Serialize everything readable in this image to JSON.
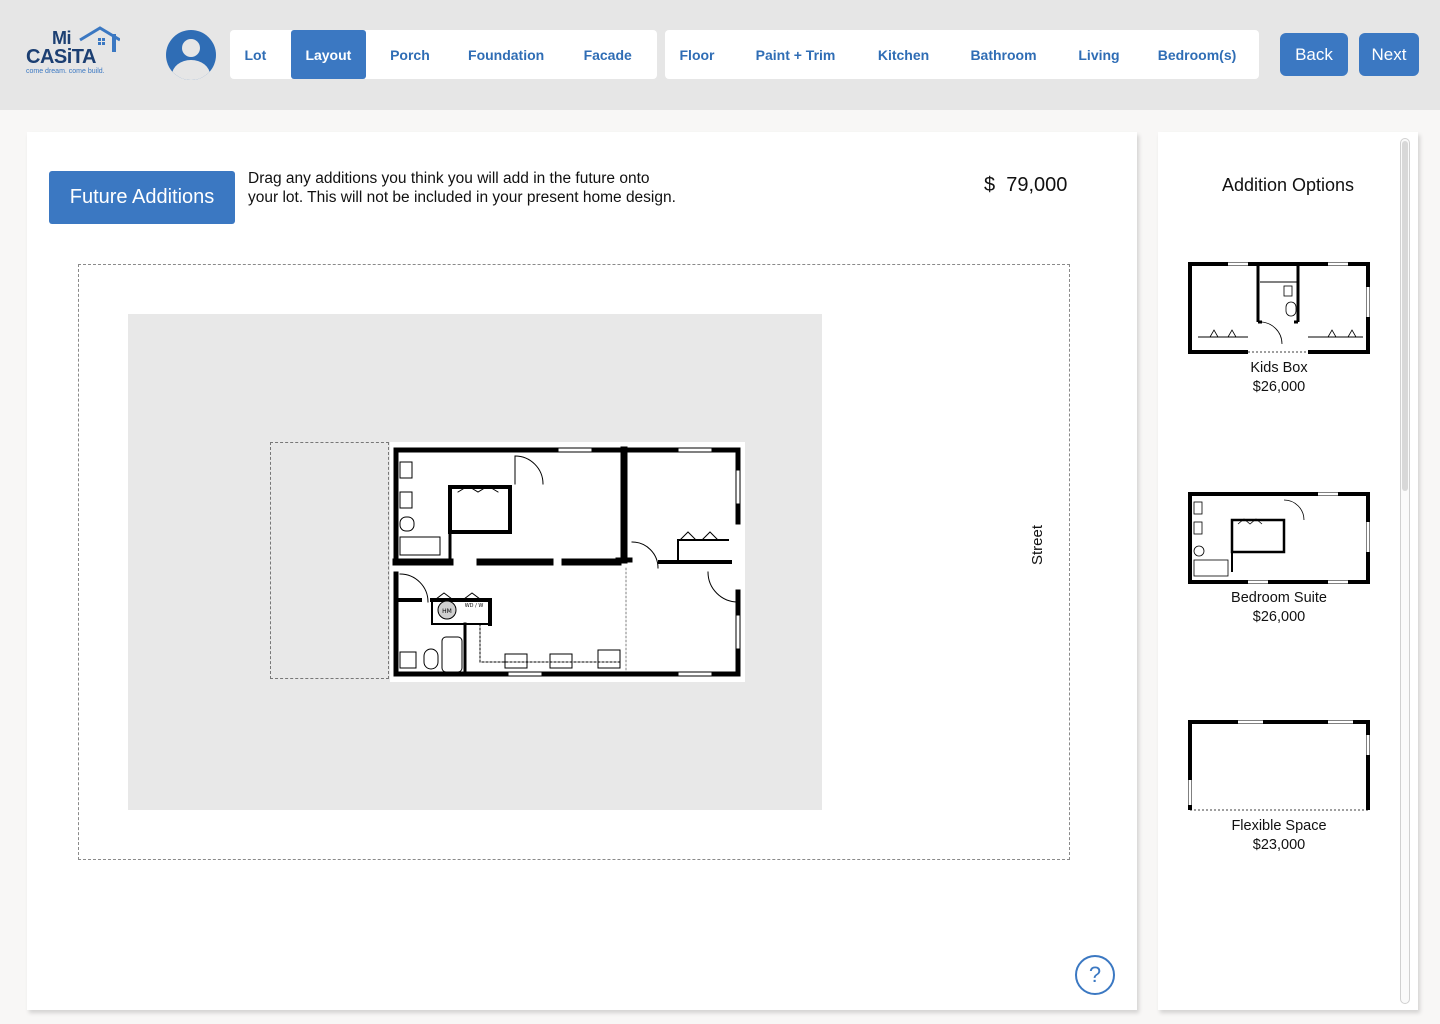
{
  "brand": {
    "line1": "Mi",
    "line2": "CASiTA",
    "tagline": "come dream. come build."
  },
  "tabs_group1": [
    {
      "label": "Lot",
      "active": false
    },
    {
      "label": "Layout",
      "active": true
    },
    {
      "label": "Porch",
      "active": false
    },
    {
      "label": "Foundation",
      "active": false
    },
    {
      "label": "Facade",
      "active": false
    }
  ],
  "tabs_group2": [
    {
      "label": "Floor"
    },
    {
      "label": "Paint + Trim"
    },
    {
      "label": "Kitchen"
    },
    {
      "label": "Bathroom"
    },
    {
      "label": "Living"
    },
    {
      "label": "Bedroom(s)"
    }
  ],
  "nav": {
    "back": "Back",
    "next": "Next"
  },
  "main": {
    "future_button": "Future Additions",
    "instructions": "Drag any additions you think you will add in the future onto your lot. This will not be included in your present home design.",
    "price_currency": "$",
    "price_value": "79,000",
    "street_label": "Street",
    "help": "?"
  },
  "side": {
    "title": "Addition Options",
    "options": [
      {
        "name": "Kids Box",
        "price": "$26,000"
      },
      {
        "name": "Bedroom Suite",
        "price": "$26,000"
      },
      {
        "name": "Flexible Space",
        "price": "$23,000"
      }
    ]
  },
  "floorplan_labels": {
    "hm": "HM",
    "wd": "WD / W"
  },
  "colors": {
    "accent": "#3b78c2",
    "header_bg": "#e6e6e6",
    "brand_dark": "#1c3f72"
  }
}
